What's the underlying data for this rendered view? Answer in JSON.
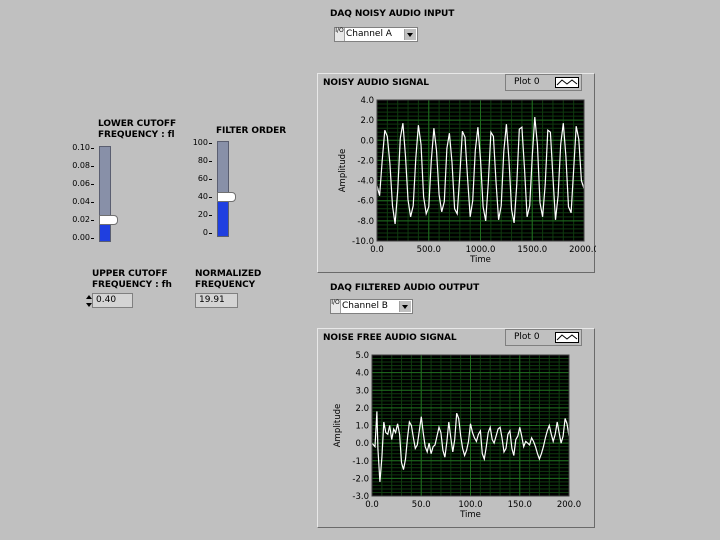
{
  "daq_input": {
    "label": "DAQ NOISY AUDIO INPUT",
    "radix": "I/O",
    "value": "Channel A"
  },
  "daq_output": {
    "label": "DAQ FILTERED AUDIO OUTPUT",
    "radix": "I/O",
    "value": "Channel B"
  },
  "lower_cutoff": {
    "label_line1": "LOWER CUTOFF",
    "label_line2": "FREQUENCY : fl",
    "ticks": [
      "0.10",
      "0.08",
      "0.06",
      "0.04",
      "0.02",
      "0.00"
    ],
    "min": 0,
    "max": 0.1,
    "value": 0.022,
    "colors": {
      "fill": "#1f3fe0",
      "track": "#8890a8"
    }
  },
  "filter_order": {
    "label": "FILTER ORDER",
    "ticks": [
      "100",
      "80",
      "60",
      "40",
      "20",
      "0"
    ],
    "min": 0,
    "max": 100,
    "value": 42
  },
  "upper_cutoff": {
    "label_line1": "UPPER CUTOFF",
    "label_line2": "FREQUENCY : fh",
    "value": "0.40"
  },
  "normalized": {
    "label_line1": "NORMALIZED",
    "label_line2": "FREQUENCY",
    "value": "19.91"
  },
  "noisy_plot": {
    "title": "NOISY AUDIO SIGNAL",
    "legend": "Plot 0"
  },
  "clean_plot": {
    "title": "NOISE FREE AUDIO SIGNAL",
    "legend": "Plot 0"
  },
  "colors": {
    "plot_bg": "#000000",
    "grid": "#1f6b1f",
    "trace": "#ffffff",
    "panel": "#c0c0c0"
  },
  "chart_data": [
    {
      "type": "line",
      "title": "NOISY AUDIO SIGNAL",
      "xlabel": "Time",
      "ylabel": "Amplitude",
      "xlim": [
        0,
        2000
      ],
      "ylim": [
        -10,
        4
      ],
      "xticks": [
        "0.0",
        "500.0",
        "1000.0",
        "1500.0",
        "2000.0"
      ],
      "yticks": [
        "4.0",
        "2.0",
        "0.0",
        "-2.0",
        "-4.0",
        "-6.0",
        "-8.0",
        "-10.0"
      ],
      "grid": true,
      "series": [
        {
          "name": "Plot 0",
          "x": [
            0,
            25,
            50,
            75,
            100,
            125,
            150,
            175,
            200,
            225,
            250,
            275,
            300,
            325,
            350,
            375,
            400,
            425,
            450,
            475,
            500,
            525,
            550,
            575,
            600,
            625,
            650,
            675,
            700,
            725,
            750,
            775,
            800,
            825,
            850,
            875,
            900,
            925,
            950,
            975,
            1000,
            1025,
            1050,
            1075,
            1100,
            1125,
            1150,
            1175,
            1200,
            1225,
            1250,
            1275,
            1300,
            1325,
            1350,
            1375,
            1400,
            1425,
            1450,
            1475,
            1500,
            1525,
            1550,
            1575,
            1600,
            1625,
            1650,
            1675,
            1700,
            1725,
            1750,
            1775,
            1800,
            1825,
            1850,
            1875,
            1900,
            1925,
            1950,
            1975,
            2000
          ],
          "values": [
            -4.5,
            -5.5,
            -2.0,
            1.0,
            0.4,
            -2.3,
            -6.5,
            -8.3,
            -5.0,
            0.2,
            1.7,
            -1.6,
            -5.9,
            -7.6,
            -6.5,
            -1.8,
            1.5,
            -0.4,
            -5.6,
            -7.3,
            -6.6,
            -2.0,
            1.2,
            -1.0,
            -5.4,
            -7.1,
            -6.1,
            -0.8,
            0.7,
            -2.2,
            -6.8,
            -7.3,
            -3.5,
            0.9,
            0.3,
            -3.8,
            -7.6,
            -6.0,
            -1.0,
            1.3,
            -1.9,
            -6.6,
            -8.0,
            -4.2,
            0.8,
            0.4,
            -4.1,
            -7.9,
            -6.5,
            -1.1,
            1.6,
            -2.0,
            -6.9,
            -8.2,
            -4.5,
            1.1,
            1.3,
            -2.8,
            -7.6,
            -6.5,
            -1.5,
            2.3,
            -0.4,
            -6.2,
            -7.6,
            -4.4,
            1.0,
            0.8,
            -3.6,
            -7.9,
            -5.5,
            -0.4,
            1.7,
            -1.6,
            -6.6,
            -7.2,
            -3.0,
            1.4,
            0.1,
            -4.0,
            -4.8
          ]
        }
      ]
    },
    {
      "type": "line",
      "title": "NOISE FREE AUDIO SIGNAL",
      "xlabel": "Time",
      "ylabel": "Amplitude",
      "xlim": [
        0,
        200
      ],
      "ylim": [
        -3,
        5
      ],
      "xticks": [
        "0.0",
        "50.0",
        "100.0",
        "150.0",
        "200.0"
      ],
      "yticks": [
        "5.0",
        "4.0",
        "3.0",
        "2.0",
        "1.0",
        "0.0",
        "-1.0",
        "-2.0",
        "-3.0"
      ],
      "grid": true,
      "series": [
        {
          "name": "Plot 0",
          "x": [
            0,
            3,
            5,
            6,
            8,
            10,
            12,
            14,
            16,
            18,
            20,
            22,
            24,
            26,
            28,
            30,
            32,
            34,
            36,
            38,
            40,
            42,
            44,
            46,
            48,
            50,
            52,
            54,
            56,
            58,
            60,
            62,
            64,
            66,
            68,
            70,
            72,
            74,
            76,
            78,
            80,
            82,
            84,
            86,
            88,
            90,
            92,
            94,
            96,
            98,
            100,
            102,
            104,
            106,
            108,
            110,
            112,
            114,
            116,
            118,
            120,
            122,
            124,
            126,
            128,
            130,
            132,
            134,
            136,
            138,
            140,
            142,
            144,
            146,
            148,
            150,
            152,
            154,
            156,
            158,
            160,
            162,
            164,
            166,
            168,
            170,
            172,
            174,
            176,
            178,
            180,
            182,
            184,
            186,
            188,
            190,
            192,
            194,
            196,
            198,
            200
          ],
          "values": [
            0.0,
            -0.2,
            1.8,
            -0.3,
            -2.2,
            -0.8,
            1.2,
            0.6,
            0.5,
            1.0,
            0.2,
            0.8,
            0.6,
            1.1,
            0.5,
            -1.1,
            -1.5,
            -0.9,
            0.3,
            1.2,
            1.0,
            0.3,
            -0.3,
            -0.1,
            0.7,
            1.5,
            0.6,
            -0.2,
            -0.5,
            0.0,
            -0.6,
            -0.2,
            -0.1,
            0.4,
            0.9,
            0.6,
            -0.4,
            -0.8,
            0.1,
            1.2,
            0.3,
            -0.5,
            0.2,
            1.7,
            1.4,
            0.4,
            -0.3,
            -0.7,
            -0.4,
            0.1,
            1.1,
            0.6,
            0.3,
            0.1,
            0.5,
            0.7,
            -0.6,
            -0.9,
            -0.2,
            0.6,
            0.9,
            0.2,
            0.0,
            0.4,
            0.8,
            0.9,
            0.3,
            -0.5,
            -0.3,
            0.5,
            0.7,
            -0.3,
            -0.7,
            0.2,
            0.4,
            0.9,
            0.4,
            -0.2,
            0.1,
            0.0,
            -0.1,
            0.3,
            0.1,
            -0.2,
            -0.6,
            -0.9,
            -0.6,
            -0.2,
            0.3,
            0.7,
            1.0,
            0.5,
            0.1,
            0.5,
            1.2,
            0.6,
            0.0,
            0.4,
            1.4,
            1.1,
            0.4
          ]
        }
      ]
    }
  ]
}
